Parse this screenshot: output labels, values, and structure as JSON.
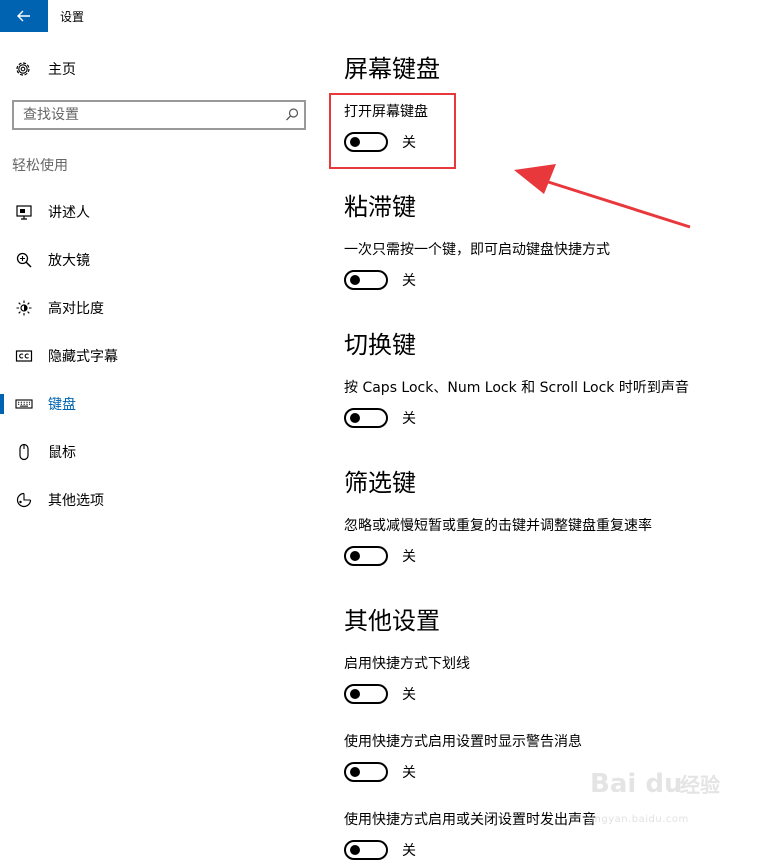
{
  "app": {
    "title": "设置"
  },
  "sidebar": {
    "home_label": "主页",
    "search_placeholder": "查找设置",
    "section_label": "轻松使用",
    "items": [
      {
        "label": "讲述人",
        "icon": "narrator-icon"
      },
      {
        "label": "放大镜",
        "icon": "magnifier-icon"
      },
      {
        "label": "高对比度",
        "icon": "high-contrast-icon"
      },
      {
        "label": "隐藏式字幕",
        "icon": "closed-captions-icon"
      },
      {
        "label": "键盘",
        "icon": "keyboard-icon",
        "active": true
      },
      {
        "label": "鼠标",
        "icon": "mouse-icon"
      },
      {
        "label": "其他选项",
        "icon": "other-options-icon"
      }
    ]
  },
  "sections": {
    "osk": {
      "title": "屏幕键盘",
      "label": "打开屏幕键盘",
      "state": "关"
    },
    "sticky": {
      "title": "粘滞键",
      "label": "一次只需按一个键，即可启动键盘快捷方式",
      "state": "关"
    },
    "toggle_keys": {
      "title": "切换键",
      "label": "按 Caps Lock、Num Lock 和 Scroll Lock 时听到声音",
      "state": "关"
    },
    "filter_keys": {
      "title": "筛选键",
      "label": "忽略或减慢短暂或重复的击键并调整键盘重复速率",
      "state": "关"
    },
    "other": {
      "title": "其他设置",
      "items": [
        {
          "label": "启用快捷方式下划线",
          "state": "关"
        },
        {
          "label": "使用快捷方式启用设置时显示警告消息",
          "state": "关"
        },
        {
          "label": "使用快捷方式启用或关闭设置时发出声音",
          "state": "关"
        }
      ]
    }
  },
  "colors": {
    "accent": "#0063b1",
    "annotation": "#e8383c"
  },
  "watermark": {
    "brand": "Bai du 经验",
    "url": "jingyan.baidu.com"
  }
}
